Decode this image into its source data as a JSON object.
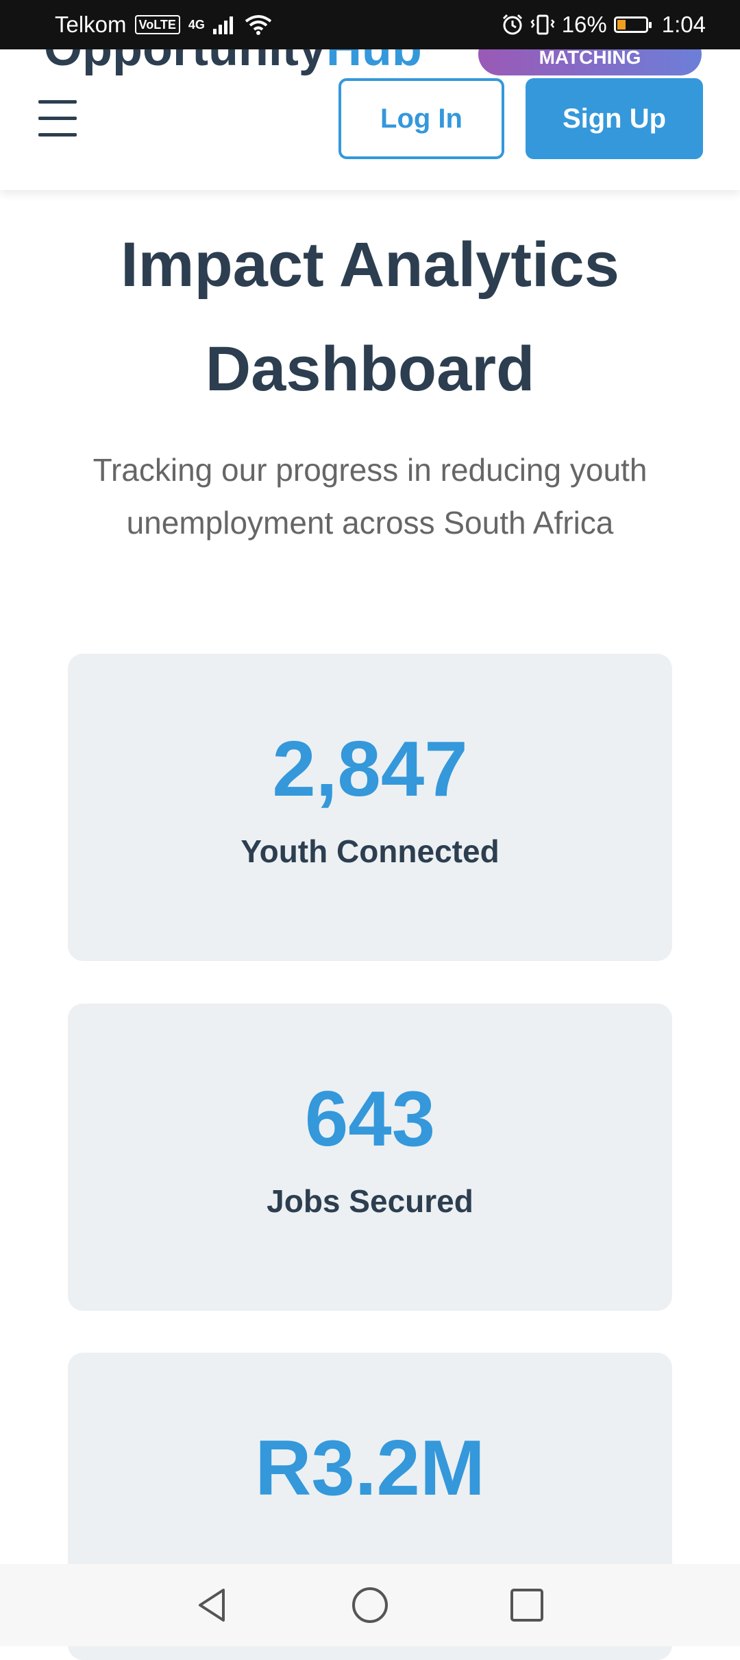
{
  "status_bar": {
    "carrier": "Telkom",
    "volte": "VoLTE",
    "network": "4G",
    "battery_percent": "16%",
    "time": "1:04"
  },
  "header": {
    "logo_text": "Opportunity",
    "logo_accent": "Hub",
    "badge": "MATCHING",
    "login_label": "Log In",
    "signup_label": "Sign Up"
  },
  "page": {
    "title": "Impact Analytics Dashboard",
    "subtitle": "Tracking our progress in reducing youth unemployment across South Africa"
  },
  "stats": [
    {
      "value": "2,847",
      "label": "Youth Connected"
    },
    {
      "value": "643",
      "label": "Jobs Secured"
    },
    {
      "value": "R3.2M",
      "label": ""
    }
  ]
}
